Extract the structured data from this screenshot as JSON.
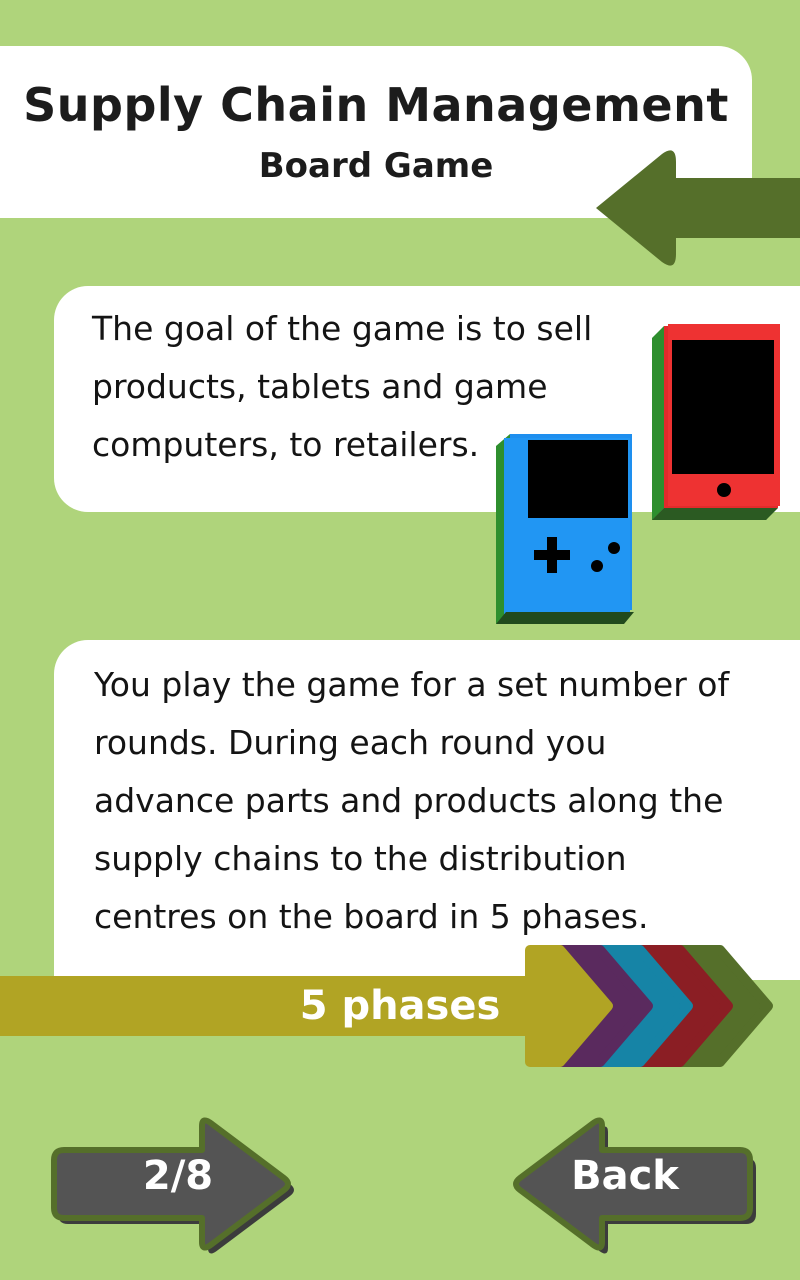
{
  "header": {
    "title": "Supply Chain Management",
    "subtitle": "Board Game"
  },
  "cards": {
    "goal_text": "The goal of the game is to sell\nproducts, tablets and game\ncomputers, to retailers.",
    "rounds_text": "You play the game for a set number of\nrounds. During each round you\nadvance parts and products along the\nsupply chains  to the distribution\ncentres on the board in 5 phases."
  },
  "phases": {
    "label": "5 phases",
    "colors": [
      "#b1a424",
      "#5a2a5e",
      "#1684a6",
      "#8b1e24",
      "#556f2a"
    ]
  },
  "nav": {
    "page_indicator": "2/8",
    "back_label": "Back"
  },
  "icons": {
    "top_arrow": "left-arrow-icon",
    "tablet": "tablet-icon",
    "handheld": "handheld-game-icon"
  },
  "colors": {
    "background": "#afd47b",
    "dark_green": "#556f2a",
    "button_gray": "#545454"
  }
}
